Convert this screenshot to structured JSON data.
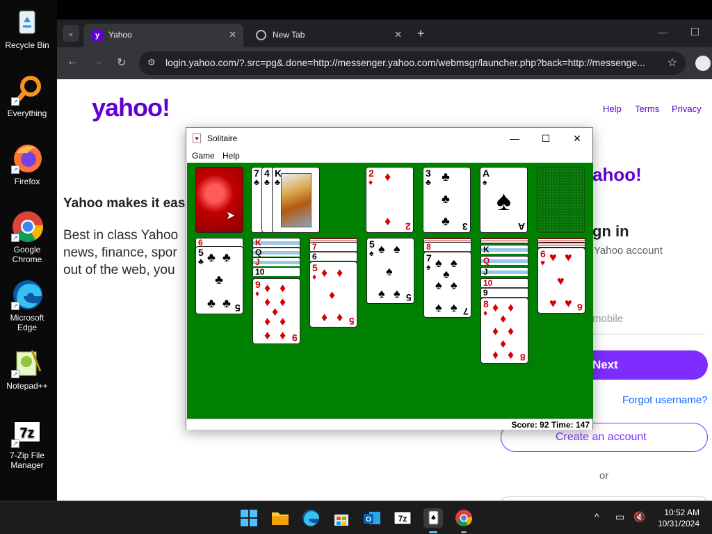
{
  "desktop": {
    "icons": [
      {
        "label": "Recycle Bin"
      },
      {
        "label": "Everything"
      },
      {
        "label": "Firefox"
      },
      {
        "label": "Google Chrome"
      },
      {
        "label": "Microsoft Edge"
      },
      {
        "label": "Notepad++"
      },
      {
        "label": "7-Zip File Manager"
      }
    ]
  },
  "browser": {
    "tabs": [
      {
        "title": "Yahoo",
        "active": true
      },
      {
        "title": "New Tab",
        "active": false
      }
    ],
    "new_tab_symbol": "+",
    "url": "login.yahoo.com/?.src=pg&.done=http://messenger.yahoo.com/webmsgr/launcher.php?back=http://messenge..."
  },
  "yahoo": {
    "logo": "yahoo!",
    "links": [
      "Help",
      "Terms",
      "Privacy"
    ],
    "tagline": "Yahoo makes it eas",
    "body_lines": [
      "Best in class Yahoo",
      "news, finance, spor",
      "out of the web, you"
    ],
    "right": {
      "logo_fragment": "ahoo!",
      "signin_fragment": "gn in",
      "account_fragment": "Yahoo account",
      "mobile_fragment": "mobile",
      "next": "Next",
      "forgot": "Forgot username?",
      "create": "Create an account",
      "or": "or"
    }
  },
  "solitaire": {
    "title": "Solitaire",
    "menu": [
      "Game",
      "Help"
    ],
    "status": "Score: 92 Time: 147",
    "waste_ranks": [
      "7",
      "4",
      "K"
    ],
    "foundations": [
      {
        "rank": "2",
        "suit": "♦"
      },
      {
        "rank": "3",
        "suit": "♣"
      },
      {
        "rank": "A",
        "suit": "♠"
      }
    ],
    "tableau": [
      {
        "faces": [
          "6"
        ],
        "top": {
          "rank": "5",
          "suit": "♣"
        }
      },
      {
        "faces": [
          "K",
          "Q",
          "J",
          "10"
        ],
        "top": {
          "rank": "9",
          "suit": "♦"
        }
      },
      {
        "faces": [
          "7",
          "6"
        ],
        "top": {
          "rank": "5",
          "suit": "♦"
        }
      },
      {
        "faces": [],
        "top": {
          "rank": "5",
          "suit": "♠"
        }
      },
      {
        "faces": [
          "8"
        ],
        "top": {
          "rank": "7",
          "suit": "♠"
        }
      },
      {
        "faces": [
          "K",
          "Q",
          "J",
          "10",
          "9"
        ],
        "top": {
          "rank": "8",
          "suit": "♦"
        }
      },
      {
        "faces": [],
        "top": {
          "rank": "6",
          "suit": "♥"
        }
      }
    ]
  },
  "taskbar": {
    "time": "10:52 AM",
    "date": "10/31/2024"
  }
}
